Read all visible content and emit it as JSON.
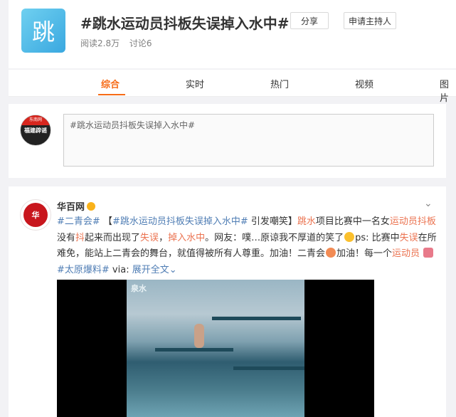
{
  "topic": {
    "icon_char": "跳",
    "title": "#跳水运动员抖板失误掉入水中#",
    "reads": "阅读2.8万",
    "discussions": "讨论6",
    "share_label": "分享",
    "apply_host_label": "申请主持人"
  },
  "tabs": [
    {
      "label": "综合",
      "active": true
    },
    {
      "label": "实时",
      "active": false
    },
    {
      "label": "热门",
      "active": false
    },
    {
      "label": "视频",
      "active": false
    },
    {
      "label": "图片",
      "active": false
    }
  ],
  "composer": {
    "avatar_top": "东南网",
    "avatar_text": "福建辟谣",
    "placeholder": "#跳水运动员抖板失误掉入水中#"
  },
  "post": {
    "author": "华百网",
    "avatar_text": "华",
    "segments": {
      "s1": "#二青会#",
      "s2": "【",
      "s3": "#跳水运动员抖板失误掉入水中#",
      "s4": " 引发嘲笑】",
      "s5": "跳水",
      "s6": "项目比赛中一名女",
      "s7": "运动员抖板",
      "s8": "没有",
      "s9": "抖",
      "s10": "起来而出现了",
      "s11": "失误",
      "s12": "，",
      "s13": "掉入水中",
      "s14": "。网友：噗…原谅我不厚道的笑了",
      "s15": "ps: 比赛中",
      "s16": "失误",
      "s17": "在所难免，能站上二青会的舞台，就值得被所有人尊重。加油！二青会",
      "s18": "加油！每一个",
      "s19": "运动员",
      "s20": "#太原爆料#",
      "s21": " via: ",
      "s22": "展开全文",
      "s23": "⌄"
    },
    "video_banner": "泉水"
  },
  "colors": {
    "accent": "#f66b17",
    "link": "#eb7350",
    "blue": "#4f7db4"
  }
}
